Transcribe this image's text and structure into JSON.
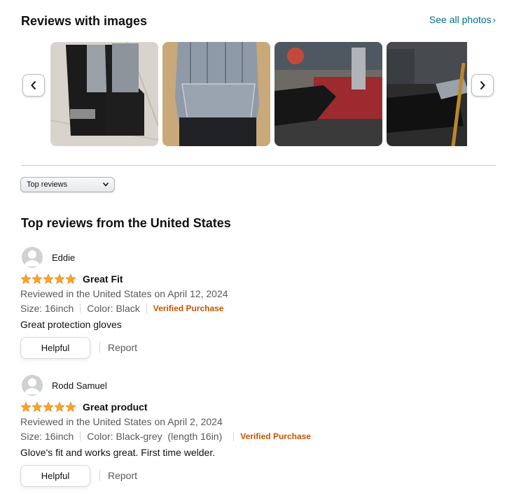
{
  "images_section": {
    "title": "Reviews with images",
    "see_all": "See all photos",
    "prev_icon": "chevron-left-icon",
    "next_icon": "chevron-right-icon",
    "thumbnails": [
      "review-photo-1",
      "review-photo-2",
      "review-photo-3",
      "review-photo-4"
    ]
  },
  "sort": {
    "selected": "Top reviews"
  },
  "reviews_heading": "Top reviews from the United States",
  "reviews": [
    {
      "author": "Eddie",
      "rating": 5,
      "title": "Great Fit",
      "date": "Reviewed in the United States on April 12, 2024",
      "size": "Size: 16inch",
      "color": "Color: Black",
      "verified": "Verified Purchase",
      "body": "Great protection gloves",
      "helpful_label": "Helpful",
      "report_label": "Report"
    },
    {
      "author": "Rodd Samuel",
      "rating": 5,
      "title": "Great product",
      "date": "Reviewed in the United States on April 2, 2024",
      "size": "Size: 16inch",
      "color": "Color: Black-grey  (length 16in)",
      "verified": "Verified Purchase",
      "body": "Glove's fit and works great. First time welder.",
      "helpful_label": "Helpful",
      "report_label": "Report"
    }
  ],
  "colors": {
    "link": "#007185",
    "star": "#ffa41c",
    "verified": "#c45500",
    "muted": "#565959"
  }
}
